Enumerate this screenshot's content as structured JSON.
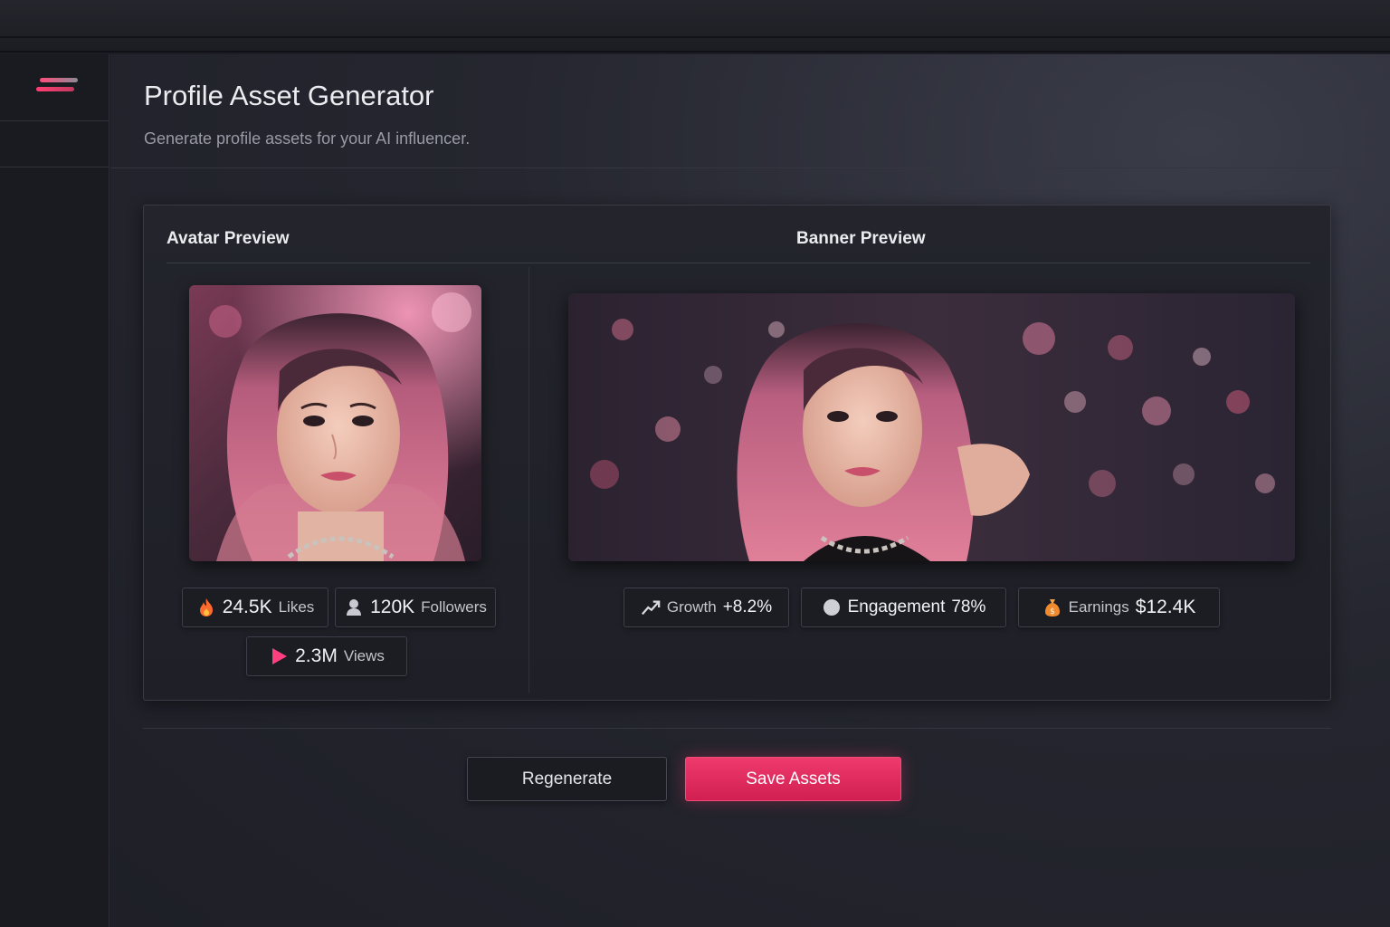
{
  "header": {
    "title": "Profile Asset Generator",
    "subtitle": "Generate profile assets for your AI influencer."
  },
  "avatar": {
    "title": "Avatar Preview",
    "stats": [
      {
        "icon": "fire-icon",
        "value": "24.5K",
        "label": "Likes"
      },
      {
        "icon": "user-icon",
        "value": "120K",
        "label": "Followers"
      },
      {
        "icon": "play-icon",
        "value": "2.3M",
        "label": "Views"
      }
    ]
  },
  "banner": {
    "title": "Banner Preview",
    "stats": [
      {
        "icon": "growth-icon",
        "label": "Growth",
        "value": "+8.2%"
      },
      {
        "icon": "circle-icon",
        "label": "Engagement",
        "value": "78%"
      },
      {
        "icon": "money-bag-icon",
        "label": "Earnings",
        "value": "$12.4K"
      }
    ]
  },
  "actions": {
    "regenerate_label": "Regenerate",
    "save_label": "Save Assets"
  },
  "colors": {
    "accent": "#e5305f",
    "background": "#1d1e25",
    "hair": "#d6708f"
  }
}
